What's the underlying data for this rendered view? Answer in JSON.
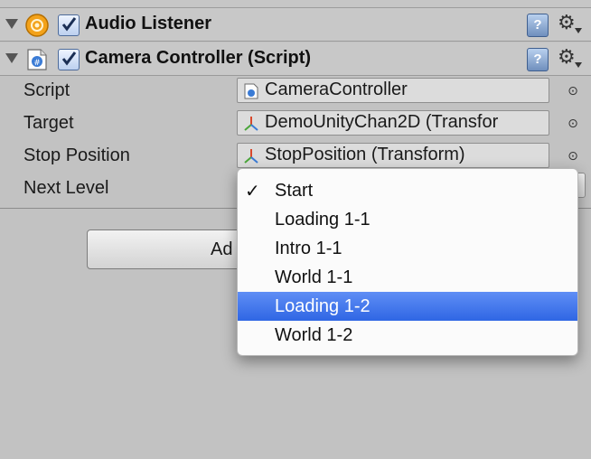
{
  "components": [
    {
      "title": "Audio Listener",
      "enabled": true,
      "help_label": "?",
      "gear_glyph": "⚙"
    },
    {
      "title": "Camera Controller (Script)",
      "enabled": true,
      "help_label": "?",
      "gear_glyph": "⚙"
    }
  ],
  "properties": {
    "script": {
      "label": "Script",
      "value": "CameraController"
    },
    "target": {
      "label": "Target",
      "value": "DemoUnityChan2D (Transfor"
    },
    "stop_position": {
      "label": "Stop Position",
      "value": "StopPosition (Transform)"
    },
    "next_level": {
      "label": "Next Level"
    }
  },
  "picker_glyph": "⊙",
  "add_component": {
    "label": "Ad"
  },
  "dropdown": {
    "checkmark": "✓",
    "selected_index": 0,
    "highlighted_index": 4,
    "options": [
      "Start",
      "Loading 1-1",
      "Intro 1-1",
      "World 1-1",
      "Loading 1-2",
      "World 1-2"
    ]
  },
  "colors": {
    "highlight": "#3b6fe8",
    "audio_icon": "#f3a21a",
    "transform_red": "#d9482b",
    "transform_green": "#4aa63a",
    "transform_blue": "#3a7bd5"
  }
}
